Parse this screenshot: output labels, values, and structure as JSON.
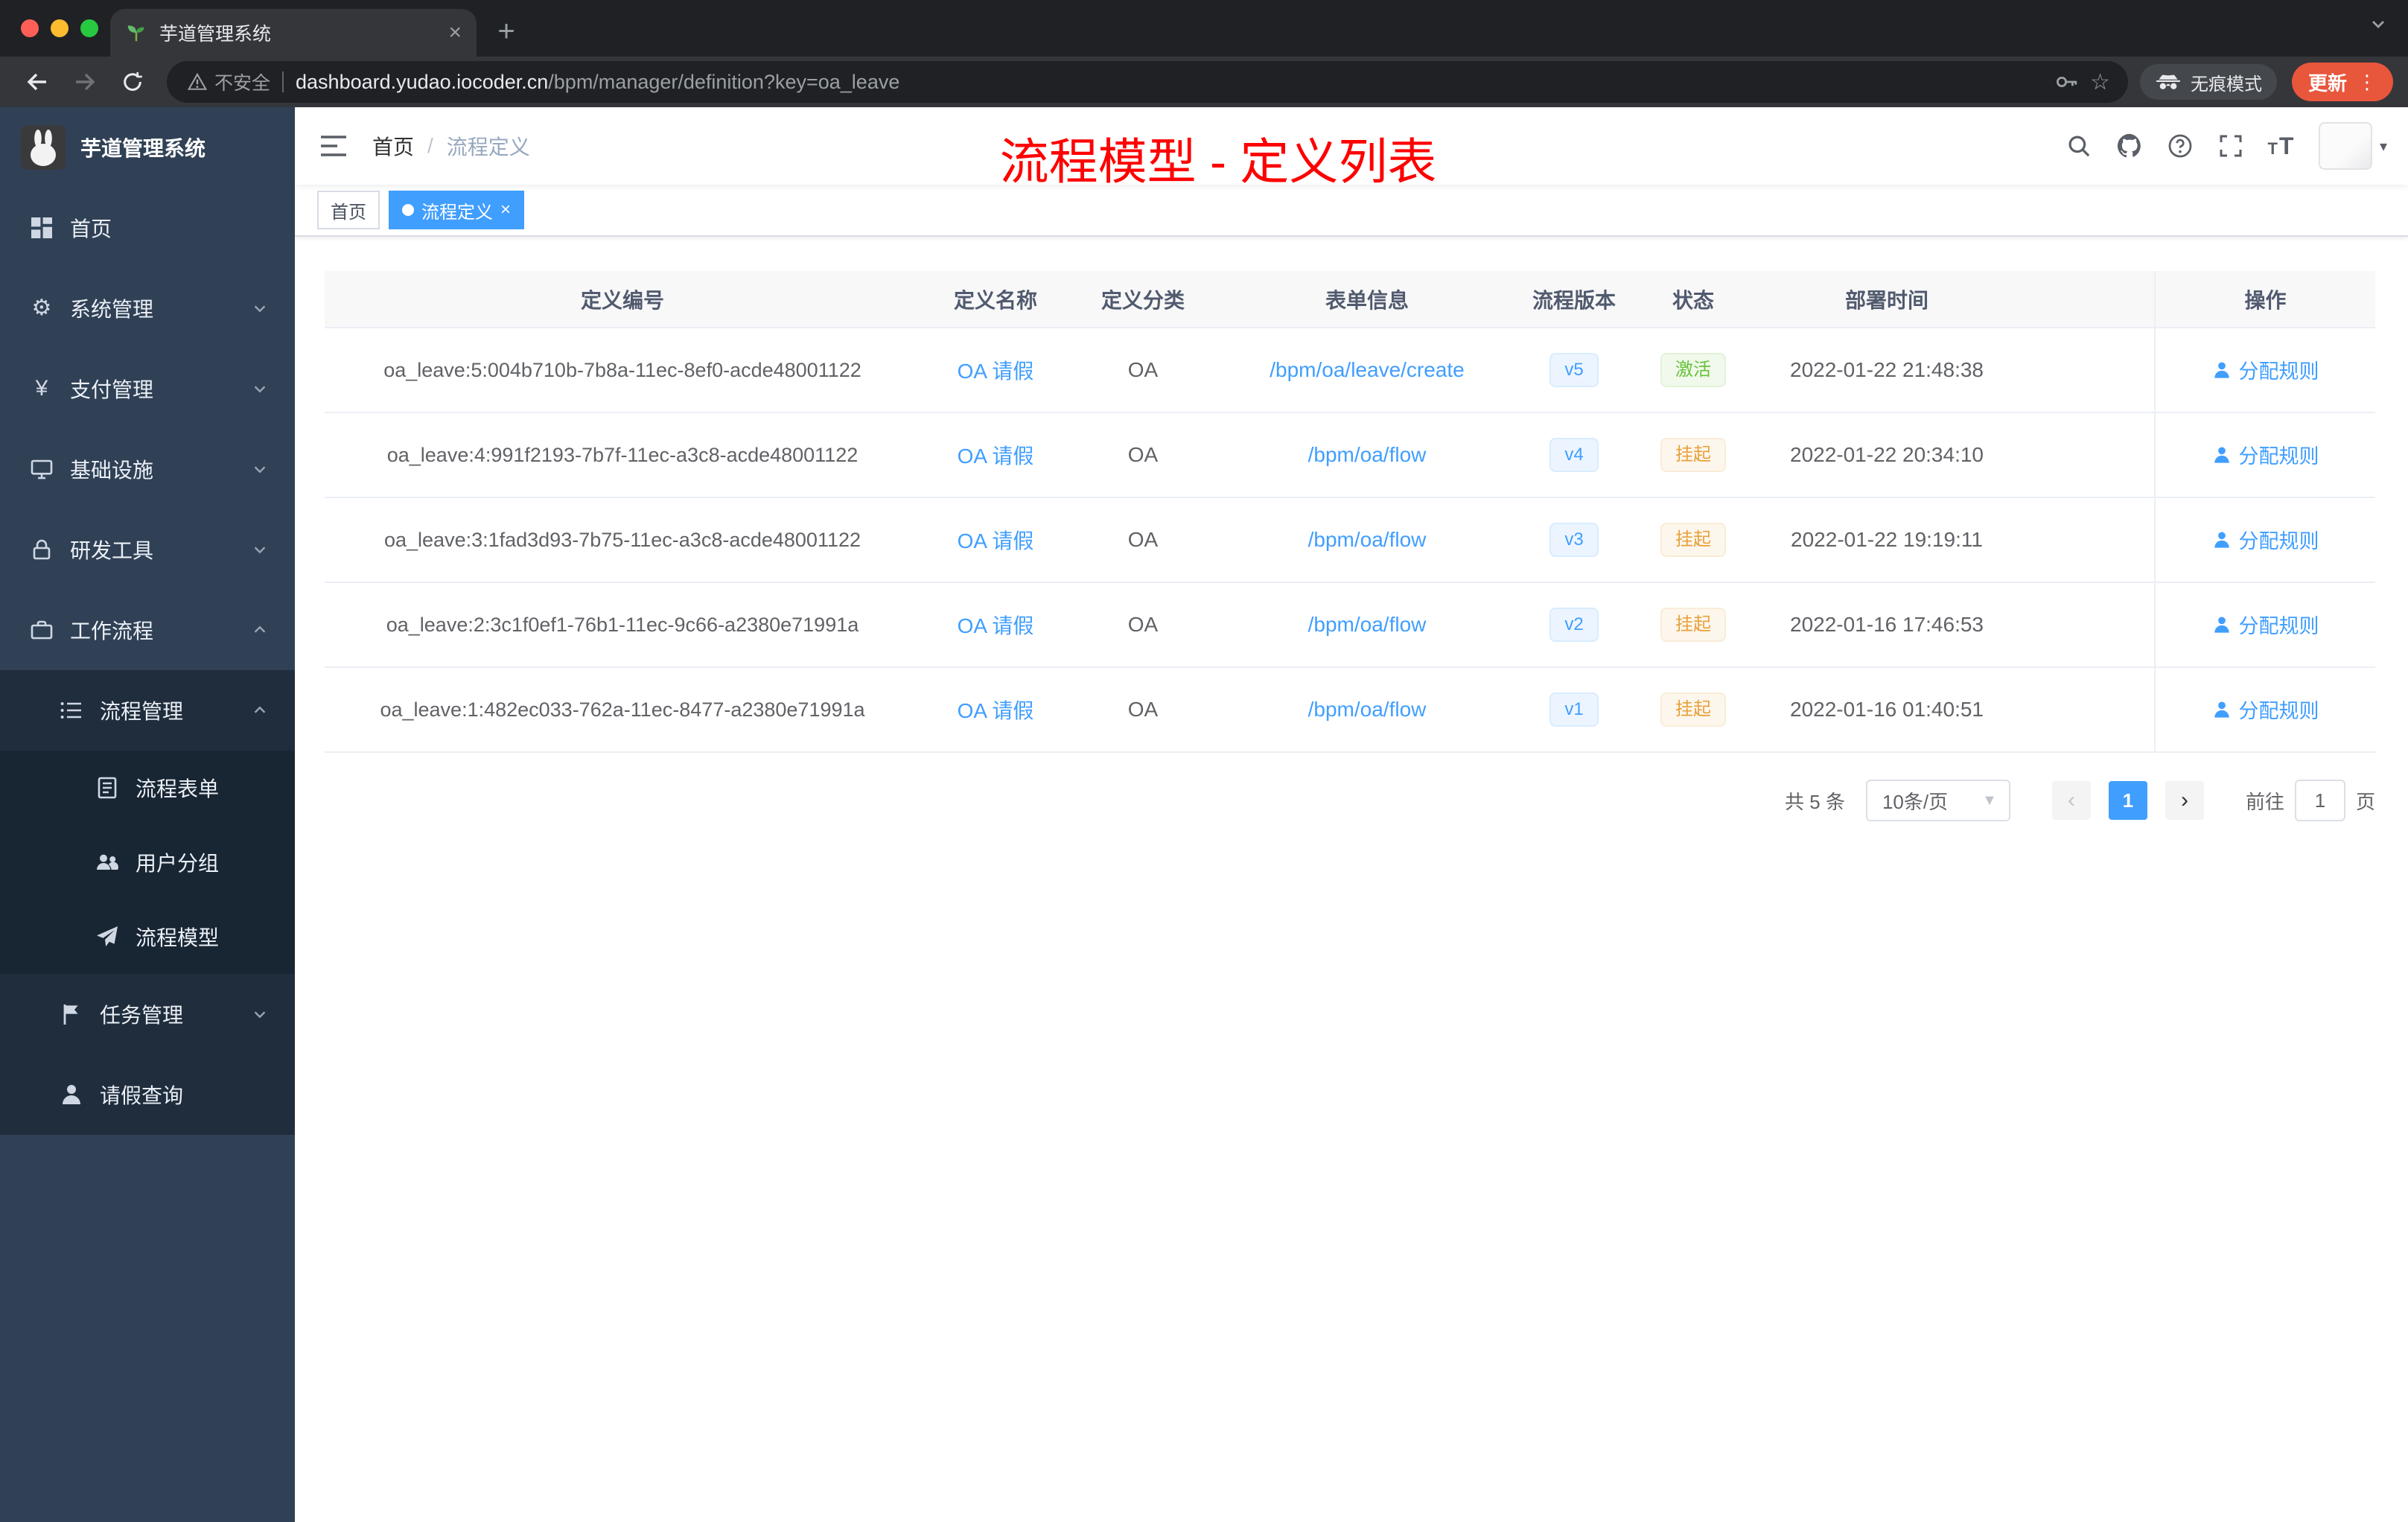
{
  "browser": {
    "tab_title": "芋道管理系统",
    "security_label": "不安全",
    "url_host": "dashboard.yudao.iocoder.cn",
    "url_path": "/bpm/manager/definition?key=oa_leave",
    "incognito_label": "无痕模式",
    "update_label": "更新"
  },
  "sidebar": {
    "logo_title": "芋道管理系统",
    "items": [
      {
        "label": "首页"
      },
      {
        "label": "系统管理"
      },
      {
        "label": "支付管理"
      },
      {
        "label": "基础设施"
      },
      {
        "label": "研发工具"
      },
      {
        "label": "工作流程"
      },
      {
        "label": "流程管理"
      },
      {
        "label": "流程表单"
      },
      {
        "label": "用户分组"
      },
      {
        "label": "流程模型"
      },
      {
        "label": "任务管理"
      },
      {
        "label": "请假查询"
      }
    ]
  },
  "navbar": {
    "breadcrumb_home": "首页",
    "breadcrumb_current": "流程定义",
    "annotation": "流程模型 - 定义列表"
  },
  "tags": {
    "home": "首页",
    "current": "流程定义"
  },
  "table": {
    "columns": [
      "定义编号",
      "定义名称",
      "定义分类",
      "表单信息",
      "流程版本",
      "状态",
      "部署时间",
      "操作"
    ],
    "rows": [
      {
        "id": "oa_leave:5:004b710b-7b8a-11ec-8ef0-acde48001122",
        "name": "OA 请假",
        "category": "OA",
        "form": "/bpm/oa/leave/create",
        "version": "v5",
        "status": "激活",
        "deployed": "2022-01-22 21:48:38",
        "action": "分配规则"
      },
      {
        "id": "oa_leave:4:991f2193-7b7f-11ec-a3c8-acde48001122",
        "name": "OA 请假",
        "category": "OA",
        "form": "/bpm/oa/flow",
        "version": "v4",
        "status": "挂起",
        "deployed": "2022-01-22 20:34:10",
        "action": "分配规则"
      },
      {
        "id": "oa_leave:3:1fad3d93-7b75-11ec-a3c8-acde48001122",
        "name": "OA 请假",
        "category": "OA",
        "form": "/bpm/oa/flow",
        "version": "v3",
        "status": "挂起",
        "deployed": "2022-01-22 19:19:11",
        "action": "分配规则"
      },
      {
        "id": "oa_leave:2:3c1f0ef1-76b1-11ec-9c66-a2380e71991a",
        "name": "OA 请假",
        "category": "OA",
        "form": "/bpm/oa/flow",
        "version": "v2",
        "status": "挂起",
        "deployed": "2022-01-16 17:46:53",
        "action": "分配规则"
      },
      {
        "id": "oa_leave:1:482ec033-762a-11ec-8477-a2380e71991a",
        "name": "OA 请假",
        "category": "OA",
        "form": "/bpm/oa/flow",
        "version": "v1",
        "status": "挂起",
        "deployed": "2022-01-16 01:40:51",
        "action": "分配规则"
      }
    ]
  },
  "pagination": {
    "total": "共 5 条",
    "page_size": "10条/页",
    "page": "1",
    "goto_label": "前往",
    "goto_value": "1",
    "unit_label": "页"
  },
  "colors": {
    "accent_blue": "#409eff",
    "success_green": "#67c23a",
    "warning_orange": "#e6a23c",
    "annotation_red": "#ff0000",
    "sidebar_bg": "#304156",
    "submenu_bg": "#1f2d3d"
  }
}
